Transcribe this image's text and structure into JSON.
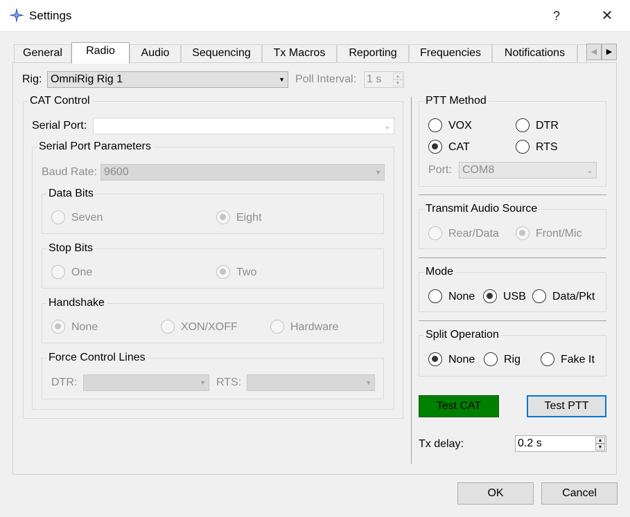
{
  "window": {
    "title": "Settings",
    "help": "?",
    "close": "✕"
  },
  "tabs": [
    {
      "label": "General"
    },
    {
      "label": "Radio"
    },
    {
      "label": "Audio"
    },
    {
      "label": "Sequencing"
    },
    {
      "label": "Tx Macros"
    },
    {
      "label": "Reporting"
    },
    {
      "label": "Frequencies"
    },
    {
      "label": "Notifications"
    }
  ],
  "active_tab": "Radio",
  "tab_scroll": {
    "left": "◀",
    "right": "▶"
  },
  "rig": {
    "label": "Rig:",
    "value": "OmniRig Rig 1",
    "poll_label": "Poll Interval:",
    "poll_value": "1 s"
  },
  "cat": {
    "title": "CAT Control",
    "serial_port_label": "Serial Port:",
    "serial_port_value": "",
    "params_title": "Serial Port Parameters",
    "baud_label": "Baud Rate:",
    "baud_value": "9600",
    "data_bits": {
      "title": "Data Bits",
      "seven": "Seven",
      "eight": "Eight",
      "selected": "Eight"
    },
    "stop_bits": {
      "title": "Stop Bits",
      "one": "One",
      "two": "Two",
      "selected": "Two"
    },
    "handshake": {
      "title": "Handshake",
      "none": "None",
      "xon": "XON/XOFF",
      "hardware": "Hardware",
      "selected": "None"
    },
    "force": {
      "title": "Force Control Lines",
      "dtr_label": "DTR:",
      "rts_label": "RTS:",
      "dtr_value": "",
      "rts_value": ""
    }
  },
  "ptt": {
    "title": "PTT Method",
    "vox": "VOX",
    "dtr": "DTR",
    "cat": "CAT",
    "rts": "RTS",
    "selected": "CAT",
    "port_label": "Port:",
    "port_value": "COM8"
  },
  "audio_source": {
    "title": "Transmit Audio Source",
    "rear": "Rear/Data",
    "front": "Front/Mic",
    "selected": "Front/Mic"
  },
  "mode": {
    "title": "Mode",
    "none": "None",
    "usb": "USB",
    "data": "Data/Pkt",
    "selected": "USB"
  },
  "split": {
    "title": "Split Operation",
    "none": "None",
    "rig": "Rig",
    "fake": "Fake It",
    "selected": "None"
  },
  "buttons": {
    "test_cat": "Test CAT",
    "test_ptt": "Test PTT",
    "ok": "OK",
    "cancel": "Cancel"
  },
  "tx_delay": {
    "label": "Tx delay:",
    "value": "0.2 s"
  },
  "colors": {
    "test_cat_bg": "#008000",
    "focus_border": "#0078d7"
  }
}
